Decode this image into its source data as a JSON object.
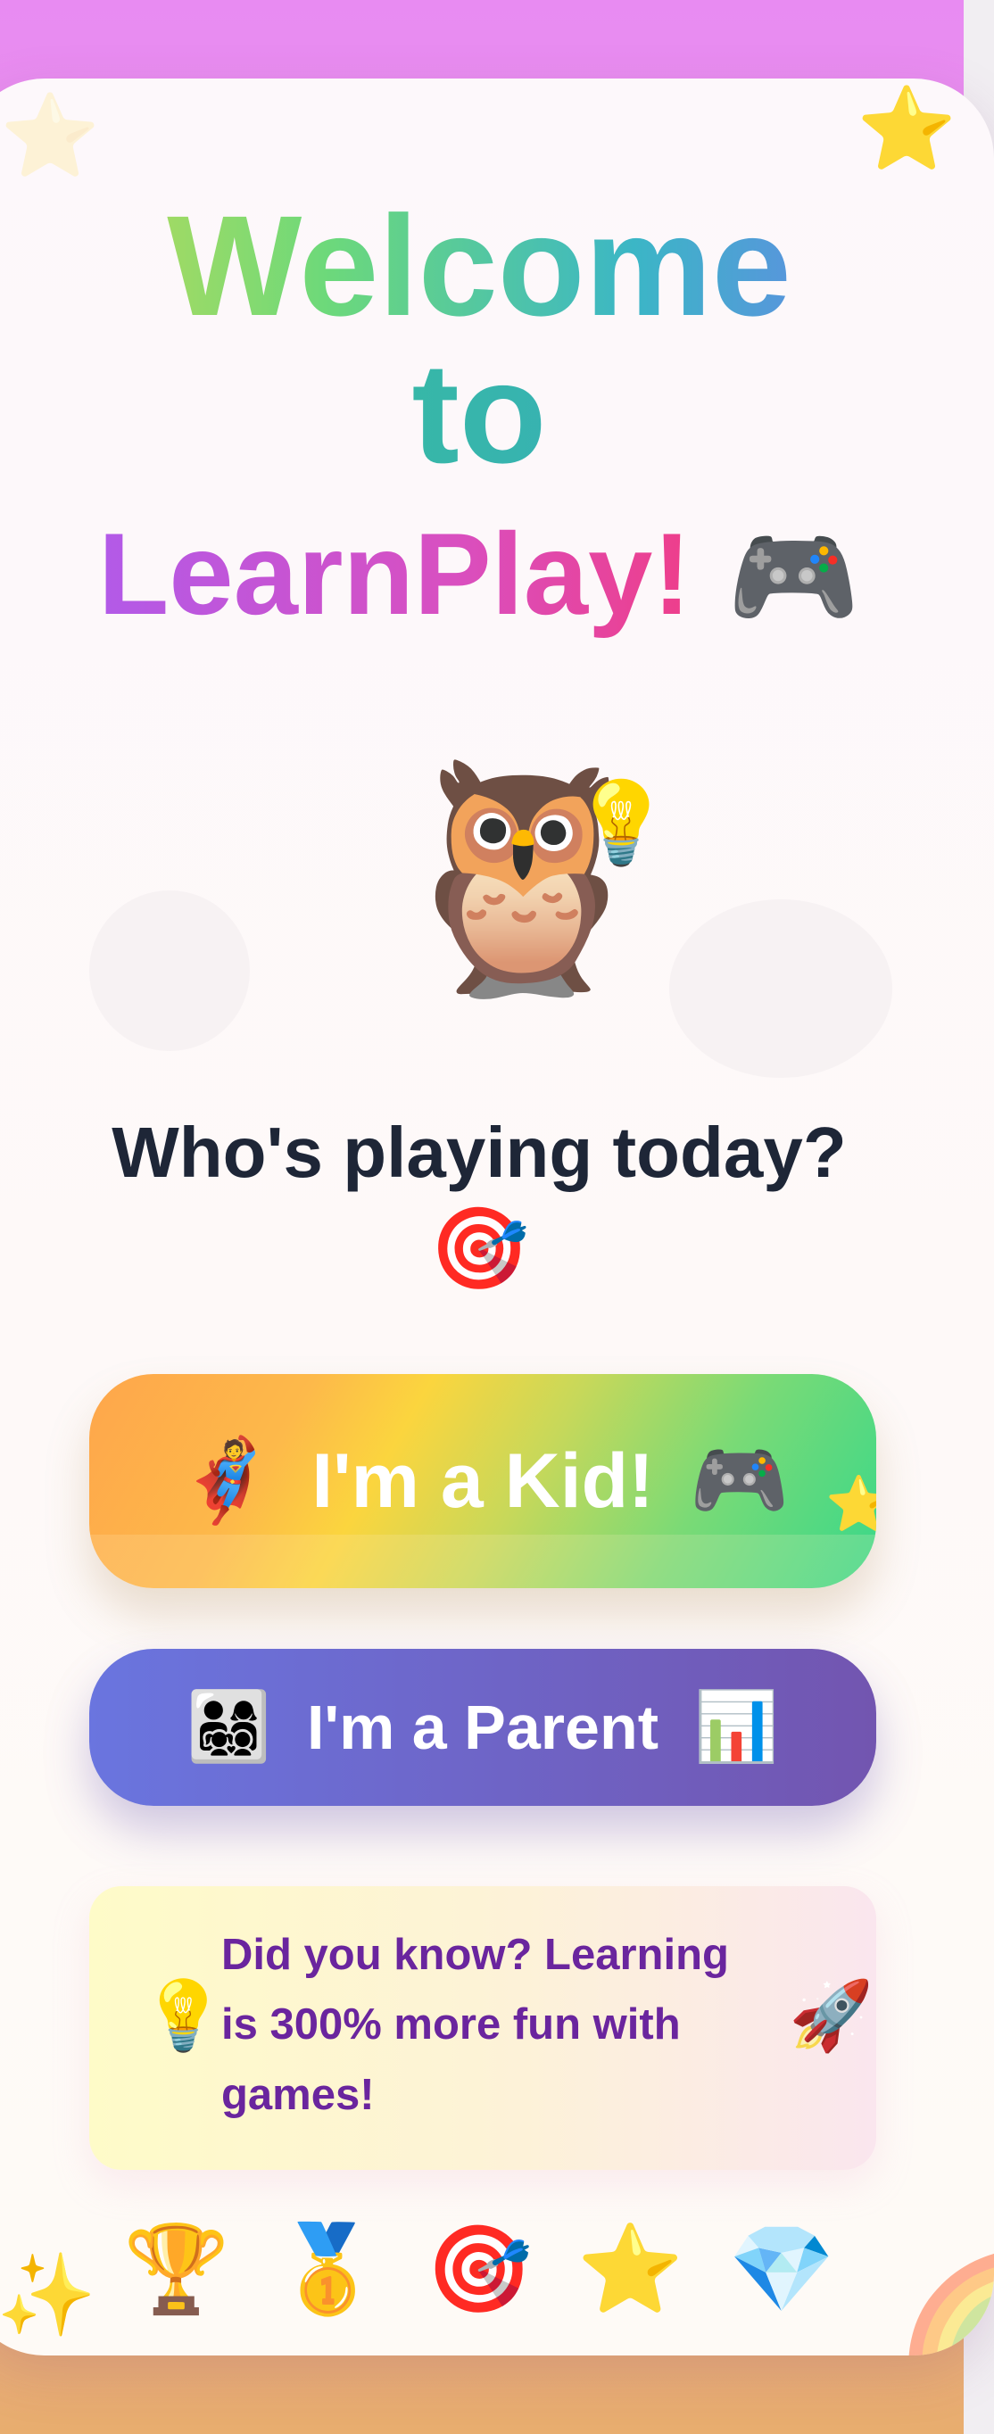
{
  "header": {
    "title_line1": "Welcome",
    "title_line2": "to",
    "brand_name": "LearnPlay!",
    "brand_emoji": "🎮"
  },
  "mascot": {
    "owl": "🦉",
    "bulb": "💡"
  },
  "prompt": {
    "question": "Who's playing today?",
    "emoji": "🎯"
  },
  "buttons": {
    "kid": {
      "label": "I'm a Kid!",
      "emoji_left": "🦸",
      "emoji_right": "🎮"
    },
    "parent": {
      "label": "I'm a Parent",
      "emoji_left": "👨‍👩‍👧‍👦",
      "emoji_right": "📊"
    }
  },
  "fact": {
    "icon": "💡",
    "text": "Did you know? Learning is 300% more fun with games!",
    "end_icon": "🚀"
  },
  "badges": [
    "🏆",
    "🥇",
    "🎯",
    "⭐",
    "💎"
  ],
  "decorations": {
    "star": "⭐",
    "sparkle": "✨",
    "rainbow": "🌈"
  },
  "colors": {
    "background_top": "#e88bf2",
    "background_bottom": "#e8ad6e",
    "kid_button_start": "#fea64b",
    "kid_button_end": "#38d88a",
    "parent_button_start": "#6a75df",
    "parent_button_end": "#7255b0",
    "fact_text": "#6a259e",
    "question_text": "#1e2637"
  }
}
